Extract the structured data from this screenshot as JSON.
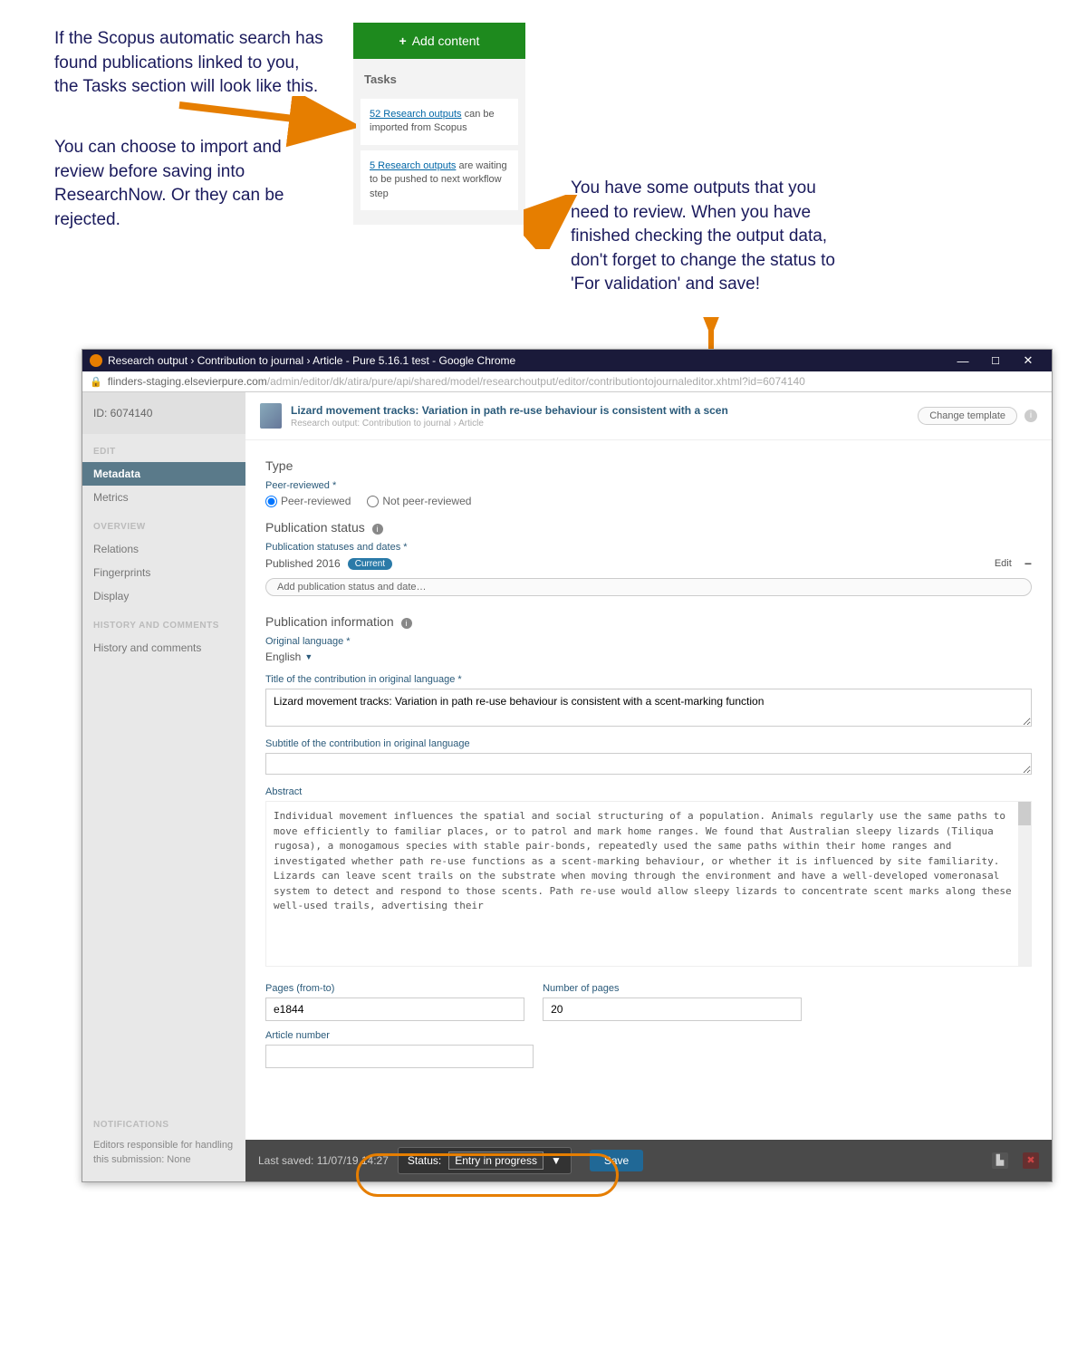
{
  "instructions": {
    "left1": "If the Scopus automatic search has found publications linked to you, the Tasks section will look like this.",
    "left2": "You can choose to import and review before saving into ResearchNow. Or they can be rejected.",
    "right": "You have some outputs that you need to review. When you have finished checking the output data, don't forget to change the status to 'For validation' and save!"
  },
  "tasks_panel": {
    "add_button": "Add content",
    "section_label": "Tasks",
    "card1": {
      "link": "52 Research outputs",
      "rest": " can be imported from Scopus"
    },
    "card2": {
      "link": "5 Research outputs",
      "rest": " are waiting to be pushed to next workflow step"
    }
  },
  "editor": {
    "window_title": "Research output › Contribution to journal › Article - Pure 5.16.1 test - Google Chrome",
    "url_host": "flinders-staging.elsevierpure.com",
    "url_path": "/admin/editor/dk/atira/pure/api/shared/model/researchoutput/editor/contributiontojournaleditor.xhtml?id=6074140",
    "id_label": "ID: 6074140",
    "change_template": "Change template",
    "header_title": "Lizard movement tracks: Variation in path re-use behaviour is consistent with a scen",
    "header_sub": "Research output: Contribution to journal › Article",
    "sections": {
      "edit": "EDIT",
      "metadata": "Metadata",
      "metrics": "Metrics",
      "overview": "OVERVIEW",
      "relations": "Relations",
      "fingerprints": "Fingerprints",
      "display": "Display",
      "history_hdr": "HISTORY AND COMMENTS",
      "history": "History and comments",
      "notifications": "NOTIFICATIONS",
      "notif_text": "Editors responsible for handling this submission: None"
    },
    "form": {
      "type": "Type",
      "peer_label": "Peer-reviewed",
      "peer_yes": "Peer-reviewed",
      "peer_no": "Not peer-reviewed",
      "pub_status": "Publication status",
      "pub_status_dates": "Publication statuses and dates",
      "pub_year": "Published 2016",
      "current": "Current",
      "edit": "Edit",
      "add_status": "Add publication status and date…",
      "pub_info": "Publication information",
      "orig_lang_label": "Original language",
      "orig_lang": "English",
      "title_label": "Title of the contribution in original language",
      "title_val": "Lizard movement tracks: Variation in path re-use behaviour is consistent with a scent-marking function",
      "subtitle_label": "Subtitle of the contribution in original language",
      "subtitle_val": "",
      "abstract_label": "Abstract",
      "abstract_val": "Individual movement influences the spatial and social structuring of a population. Animals regularly use the same paths to move efficiently to familiar places, or to patrol and mark home ranges. We found that Australian sleepy lizards (Tiliqua rugosa), a monogamous species with stable pair-bonds, repeatedly used the same paths within their home ranges and investigated whether path re-use functions as a scent-marking behaviour, or whether it is influenced by site familiarity. Lizards can leave scent trails on the substrate when moving through the environment and have a well-developed vomeronasal system to detect and respond to those scents. Path re-use would allow sleepy lizards to concentrate scent marks along these well-used trails, advertising their",
      "pages_label": "Pages (from-to)",
      "pages_val": "e1844",
      "numpages_label": "Number of pages",
      "numpages_val": "20",
      "article_label": "Article number",
      "article_val": ""
    },
    "status_bar": {
      "last_saved": "Last saved: 11/07/19 14:27",
      "status_label": "Status:",
      "status_value": "Entry in progress",
      "save": "Save"
    }
  }
}
